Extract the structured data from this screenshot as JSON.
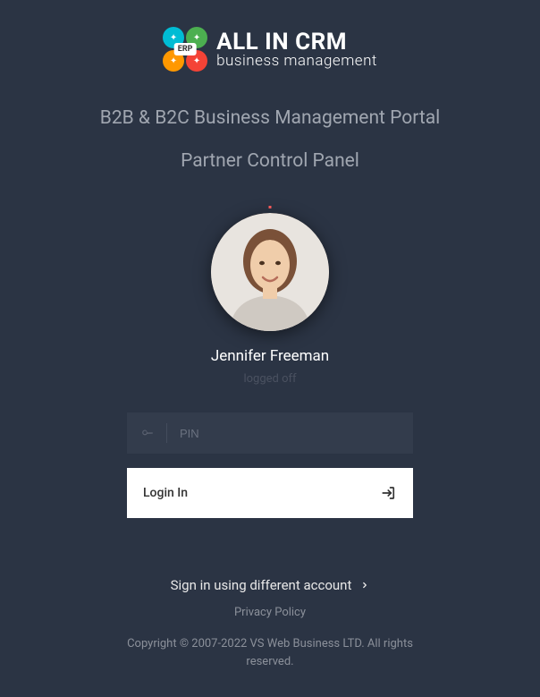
{
  "logo": {
    "erp_badge": "ERP",
    "title": "ALL IN CRM",
    "subtitle": "business management"
  },
  "headings": {
    "portal": "B2B & B2C Business Management Portal",
    "panel": "Partner Control Panel"
  },
  "user": {
    "name": "Jennifer Freeman",
    "status": "logged off"
  },
  "form": {
    "pin_placeholder": "PIN",
    "login_label": "Login In"
  },
  "links": {
    "different_account": "Sign in using different account",
    "privacy": "Privacy Policy"
  },
  "footer": {
    "copyright": "Copyright © 2007-2022 VS Web Business LTD. All rights reserved."
  },
  "icons": {
    "key": "key-icon",
    "login": "login-icon",
    "chevron_right": "chevron-right-icon"
  }
}
